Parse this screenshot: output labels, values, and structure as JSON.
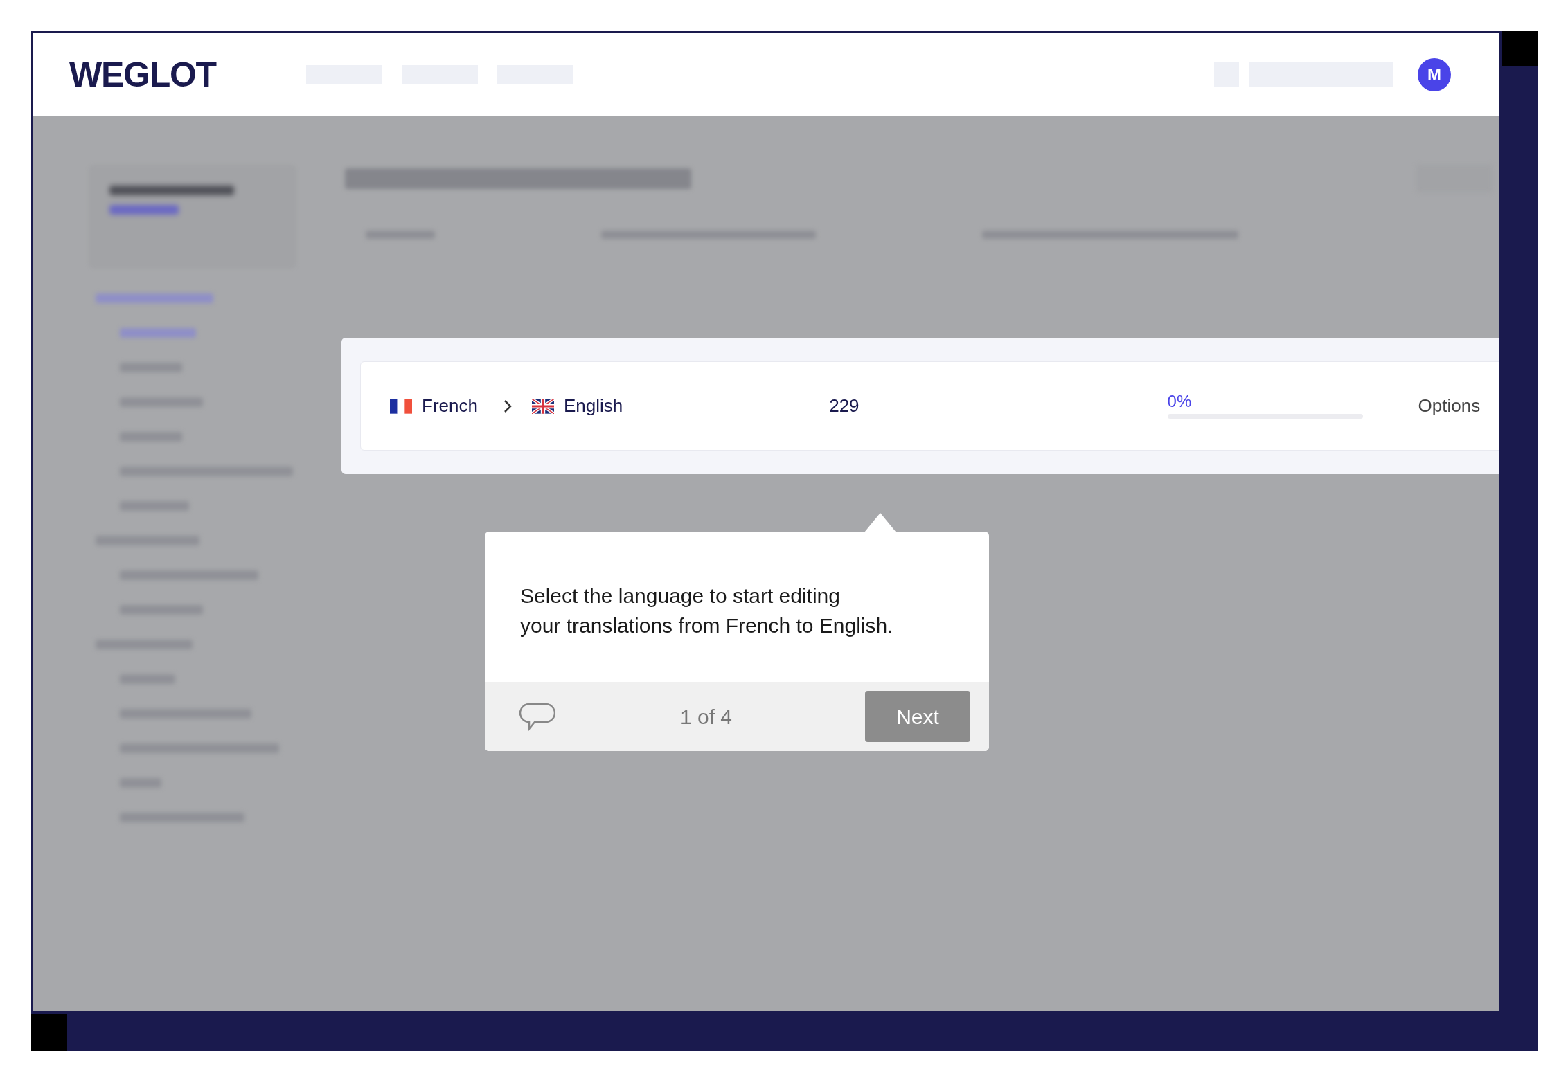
{
  "header": {
    "logo": "WEGLOT",
    "avatar": "M"
  },
  "highlighted_row": {
    "source_language": "French",
    "target_language": "English",
    "words": "229",
    "manual_percent": "0%",
    "level": 0,
    "options": "Options"
  },
  "tour": {
    "message_lines": [
      "Select the language to start editing",
      "your translations from French to English."
    ],
    "step": "1 of 4",
    "next": "Next"
  }
}
